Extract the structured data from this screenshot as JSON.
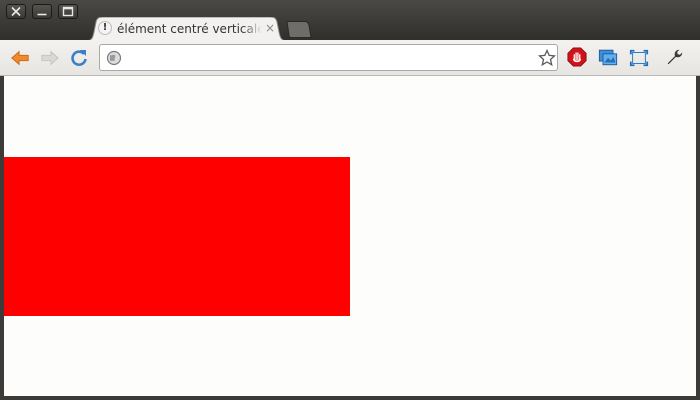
{
  "window": {
    "controls": [
      "close",
      "minimize",
      "maximize"
    ]
  },
  "tab": {
    "title": "élément centré verticalement",
    "close_glyph": "×",
    "favicon_glyph": "!"
  },
  "toolbar": {
    "icons": [
      "back-icon",
      "forward-icon",
      "reload-icon",
      "globe-icon",
      "bookmark-star-icon",
      "adblock-icon",
      "screenshot-icon",
      "fullscreen-icon",
      "wrench-icon"
    ]
  },
  "omnibox": {
    "value": ""
  },
  "content": {
    "box_color": "#ff0000",
    "background": "#fdfdfb"
  }
}
